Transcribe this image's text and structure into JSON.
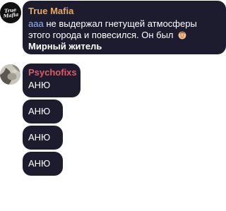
{
  "messages": [
    {
      "sender": "True Mafia",
      "sender_color": "#e6a95d",
      "avatar": {
        "logo_top": "True",
        "logo_bottom": "Mafia"
      },
      "body": {
        "line1_prefix": "ааа",
        "line1_rest": " не выдержал гнетущей атмосферы",
        "line2_text": "этого города и повесился. Он был",
        "line2_emoji": "face-emoji",
        "line3_text": "Мирный житель"
      }
    },
    {
      "sender": "Psychofixs",
      "sender_color": "#d55f68",
      "avatar": {
        "icon": "user-photo-avatar"
      },
      "bubbles": [
        "АНЮ",
        "АНЮ",
        "АНЮ",
        "АНЮ"
      ]
    }
  ],
  "colors": {
    "bubble_background": "#1d1c2e",
    "text": "#ffffff",
    "link": "#8eb8ff",
    "page_background": "#ffffff"
  }
}
